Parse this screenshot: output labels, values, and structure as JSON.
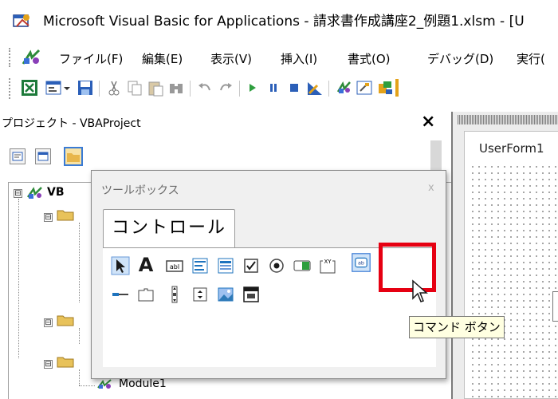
{
  "window": {
    "title": "Microsoft Visual Basic for Applications - 請求書作成講座2_例題1.xlsm - [U"
  },
  "menubar": {
    "items": [
      {
        "label": "ファイル(F)"
      },
      {
        "label": "編集(E)"
      },
      {
        "label": "表示(V)"
      },
      {
        "label": "挿入(I)"
      },
      {
        "label": "書式(O)"
      },
      {
        "label": "デバッグ(D)"
      },
      {
        "label": "実行("
      }
    ]
  },
  "project_explorer": {
    "title": "プロジェクト - VBAProject",
    "close_label": "×",
    "tree": {
      "root_label": "VB",
      "module_label": "Module1",
      "expander_symbol": "⊟"
    }
  },
  "designer": {
    "userform_title": "UserForm1"
  },
  "toolbox": {
    "title": "ツールボックス",
    "close_label": "x",
    "tab_label": "コントロール",
    "tooltip": "コマンド ボタン",
    "tools_row1": [
      "select-objects-icon",
      "label-icon",
      "textbox-icon",
      "combobox-icon",
      "listbox-icon",
      "checkbox-icon",
      "optionbutton-icon",
      "togglebutton-icon",
      "frame-icon",
      "commandbutton-icon"
    ],
    "tools_row2": [
      "tabstrip-icon",
      "multipage-icon",
      "scrollbar-icon",
      "spinbutton-icon",
      "image-icon",
      "refedit-icon"
    ],
    "label_glyph": "A",
    "textbox_glyph": "abl",
    "frame_glyph": "XY",
    "commandbutton_glyph": "ab"
  },
  "colors": {
    "highlight": "#e60012",
    "tooltip_bg": "#ffffe1",
    "accent_blue": "#1e73be"
  }
}
